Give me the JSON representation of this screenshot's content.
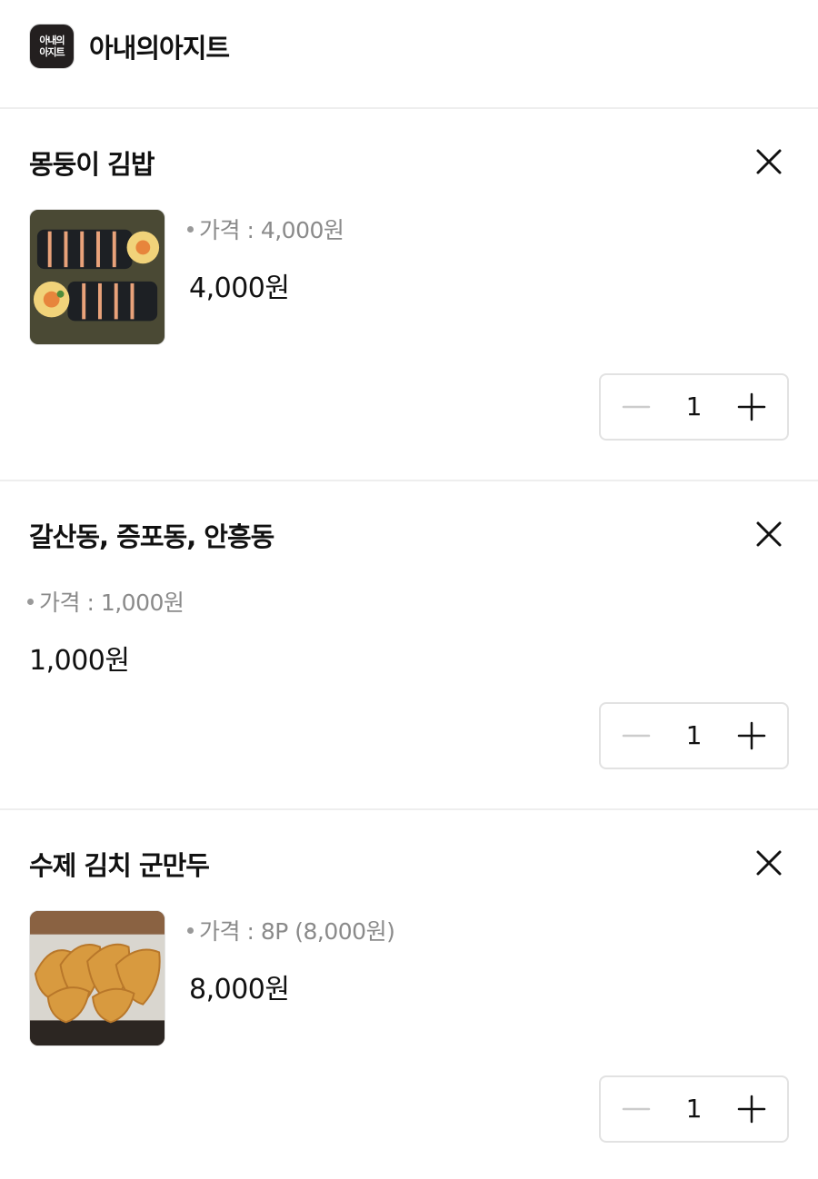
{
  "store": {
    "logo_text_line1": "아내의",
    "logo_text_line2": "아지트",
    "name": "아내의아지트"
  },
  "cart_items": [
    {
      "name": "몽둥이 김밥",
      "has_image": true,
      "image_icon": "kimbap-photo",
      "option_text": "가격 : 4,000원",
      "price": "4,000원",
      "quantity": "1"
    },
    {
      "name": "갈산동, 증포동, 안흥동",
      "has_image": false,
      "option_text": "가격 : 1,000원",
      "price": "1,000원",
      "quantity": "1"
    },
    {
      "name": "수제 김치 군만두",
      "has_image": true,
      "image_icon": "dumpling-photo",
      "option_text": "가격 : 8P (8,000원)",
      "price": "8,000원",
      "quantity": "1"
    }
  ],
  "icons": {
    "remove": "close-icon",
    "decrease": "minus-icon",
    "increase": "plus-icon"
  },
  "colors": {
    "text_primary": "#111111",
    "text_secondary": "#8a8a8a",
    "minus_disabled": "#cccccc",
    "divider": "#eeeeee",
    "logo_bg": "#231f1f"
  }
}
